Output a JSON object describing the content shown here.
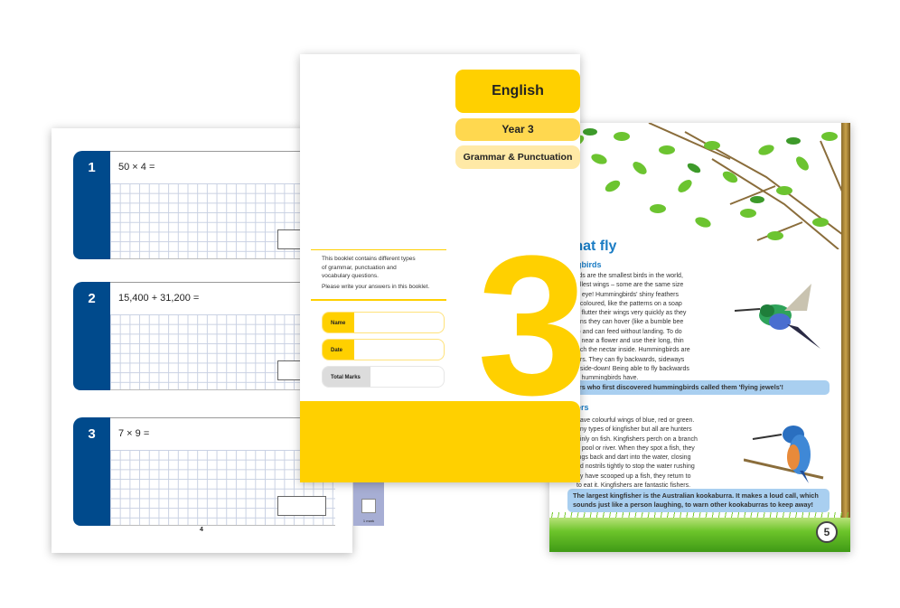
{
  "left_page": {
    "questions": [
      {
        "number": "1",
        "text": "50  ×  4 ="
      },
      {
        "number": "2",
        "text": "15,400  +  31,200 ="
      },
      {
        "number": "3",
        "text": "7  ×  9 ="
      }
    ],
    "mark_label": "1 mark",
    "page_number": "4"
  },
  "cover": {
    "subject": "English",
    "year": "Year 3",
    "topic": "Grammar & Punctuation",
    "description": [
      "This booklet contains different types",
      "of grammar, punctuation and",
      "vocabulary questions."
    ],
    "instruction": "Please write your answers in this booklet.",
    "fields": [
      {
        "label": "Name"
      },
      {
        "label": "Date"
      },
      {
        "label": "Total Marks"
      }
    ],
    "big_number": "3",
    "accent_color": "#ffd000"
  },
  "right_page": {
    "heading": "that fly",
    "section1": {
      "title": "gbirds",
      "lines": [
        "rds are the smallest birds in the world,",
        "allest wings – some are the same size",
        "n eye! Hummingbirds' shiny feathers",
        "i-coloured, like the patterns on a soap",
        "y flutter their wings very quickly as they",
        "ans they can hover (like a bumble bee",
        "r) and can feed without landing. To do",
        "y near a flower and use their long, thin",
        "ach the nectar inside. Hummingbirds are",
        "ers. They can fly backwards, sideways",
        "pside-down! Being able to fly backwards",
        "y hummingbirds have."
      ]
    },
    "callout1": "rers who first discovered hummingbirds called them 'flying jewels'!",
    "section2": {
      "title": "ers",
      "lines": [
        "have colourful wings of blue, red or green.",
        "any types of kingfisher but all are hunters",
        "ainly on fish. Kingfishers perch on a branch",
        " a pool or river. When they spot a fish, they",
        "ings back and dart into the water, closing",
        "nd nostrils tightly to stop the water rushing",
        "ey have scooped up a fish, they return to",
        "to eat it. Kingfishers are fantastic fishers."
      ]
    },
    "callout2": "The largest kingfisher is the Australian kookaburra. It makes a loud call, which sounds just like a person laughing, to warn other kookaburras to keep away!",
    "page_number": "5",
    "heading_color": "#1a7cc4",
    "callout_color": "#a9cff0"
  }
}
